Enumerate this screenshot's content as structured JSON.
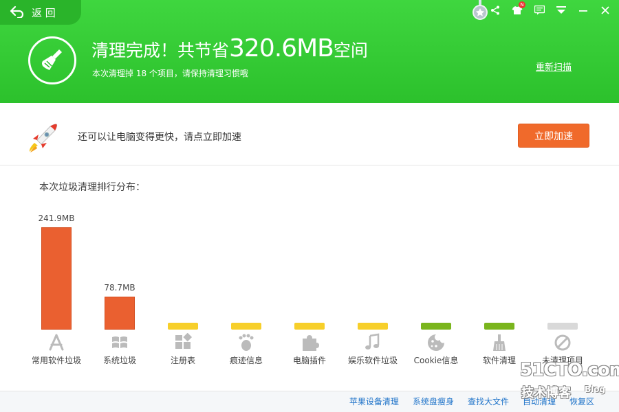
{
  "header": {
    "back_label": "返 回",
    "title_prefix": "清理完成！共节省",
    "title_amount": "320.6MB",
    "title_suffix": "空间",
    "subtitle": "本次清理掉 18 个项目，请保持清理习惯哦",
    "rescan_label": "重新扫描",
    "badge_letter": "N",
    "icons": [
      "medal-icon",
      "share-icon",
      "skin-icon",
      "message-icon",
      "menu-icon",
      "minimize-icon",
      "close-icon"
    ]
  },
  "speed": {
    "text": "还可以让电脑变得更快，请点立即加速",
    "button_label": "立即加速"
  },
  "distribution_title": "本次垃圾清理排行分布：",
  "chart_data": {
    "type": "bar",
    "categories": [
      "常用软件垃圾",
      "系统垃圾",
      "注册表",
      "痕迹信息",
      "电脑插件",
      "娱乐软件垃圾",
      "Cookie信息",
      "软件清理",
      "未清理项目"
    ],
    "values": [
      241.9,
      78.7,
      0.2,
      0.1,
      0.1,
      0.1,
      0,
      0,
      0
    ],
    "unit": "MB",
    "value_labels": [
      "241.9MB",
      "78.7MB",
      "",
      "",
      "",
      "",
      "",
      "",
      ""
    ],
    "colors": [
      "#ea6030",
      "#ea6030",
      "#f7cf2a",
      "#f7cf2a",
      "#f7cf2a",
      "#f7cf2a",
      "#7ab51d",
      "#7ab51d",
      "#d9d9d9"
    ],
    "icons": [
      "app-store-icon",
      "windows-icon",
      "registry-icon",
      "footprint-icon",
      "puzzle-icon",
      "music-icon",
      "cookie-icon",
      "broom-icon",
      "forbidden-icon"
    ],
    "ylim": [
      0,
      241.9
    ]
  },
  "bottom_links": [
    "苹果设备清理",
    "系统盘瘦身",
    "查找大文件",
    "自动清理",
    "恢复区"
  ],
  "watermark": {
    "main": "51CTO.com",
    "sub": "技术博客",
    "blog": "Blog"
  }
}
